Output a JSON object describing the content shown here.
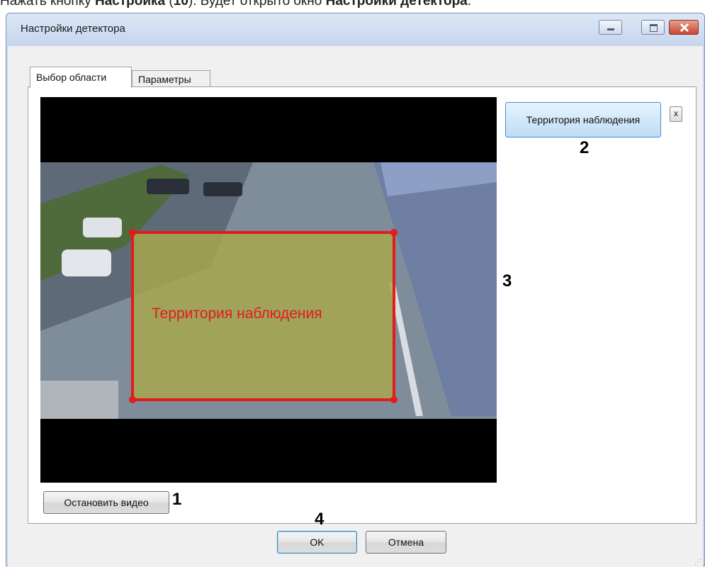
{
  "doc": {
    "prefix": "Нажать кнопку ",
    "bold1": "Настройка",
    "mid1": " (",
    "bold2": "10",
    "mid2": "). Будет открыто окно ",
    "bold3": "Настройки детектора",
    "suffix": "."
  },
  "window": {
    "title": "Настройки детектора",
    "buttons": [
      "minimize-icon",
      "maximize-icon",
      "close-icon"
    ]
  },
  "tabs": [
    {
      "label": "Выбор области",
      "active": true
    },
    {
      "label": "Параметры",
      "active": false
    }
  ],
  "video": {
    "zone_overlay_text": "Территория наблюдения",
    "zone_color": "#e31b1b",
    "zone_fill": "#a7a84a"
  },
  "zone_list": {
    "item_label": "Территория наблюдения",
    "delete_label": "x"
  },
  "buttons": {
    "stop_video": "Остановить видео",
    "ok": "OK",
    "cancel": "Отмена"
  },
  "callouts": [
    "1",
    "2",
    "3",
    "4"
  ]
}
